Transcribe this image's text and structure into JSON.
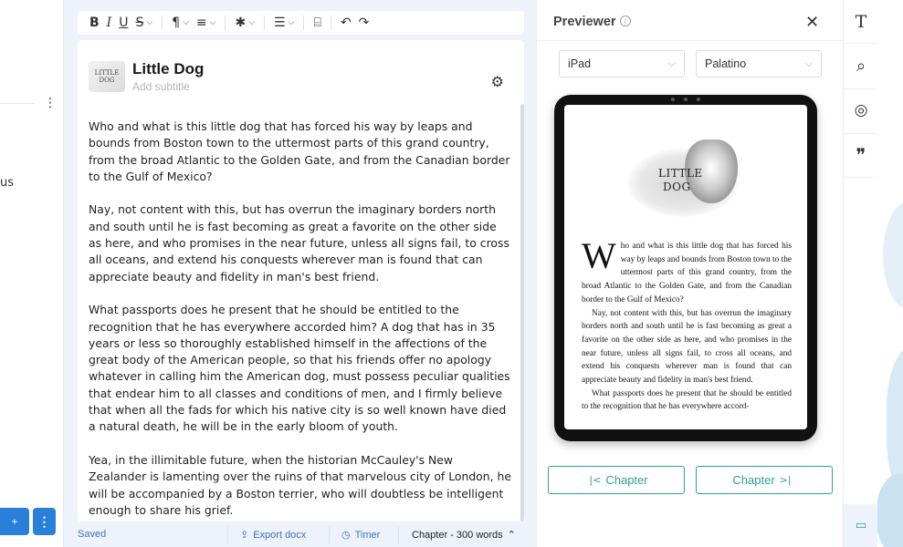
{
  "left_panel": {
    "partial_text": "us",
    "kebab_glyph": "⋮",
    "primary_glyph": "+",
    "primary_kebab_glyph": "⋮"
  },
  "toolbar": {
    "bold": "B",
    "italic": "I",
    "underline": "U",
    "strike": "S",
    "paragraph": "¶",
    "align": "≡",
    "asterisk": "✱",
    "list": "☰",
    "pagebreak": "⌸",
    "undo": "↶",
    "redo": "↷"
  },
  "chapter": {
    "logo_text": "LITTLE DOG",
    "title": "Little Dog",
    "subtitle_placeholder": "Add subtitle",
    "paragraphs": [
      "Who and what is this little dog that has forced his way by leaps and bounds from Boston town to the uttermost parts of this grand country, from the broad Atlantic to the Golden Gate, and from the Canadian border to the Gulf of Mexico?",
      "Nay, not content with this, but has overrun the imaginary borders north and south until he is fast becoming as great a favorite on the other side as here, and who promises in the near future, unless all signs fail, to cross all oceans, and extend his conquests wherever man is found that can appreciate beauty and fidelity in man's best friend.",
      "What passports does he present that he should be entitled to the recognition that he has everywhere accorded him? A dog that has in 35 years or less so thoroughly established himself in the affections of the great body of the American people, so that his friends offer no apology whatever in calling him the American dog, must possess peculiar qualities that endear him to all classes and conditions of men, and I firmly believe that when all the fads for which his native city is so well known have died a natural death, he will be in the early bloom of youth.",
      " Yea, in the illimitable future, when the historian McCauley's New Zealander is lamenting over the ruins of that marvelous city of London, he will be accompanied by a Boston terrier, who will doubtless be intelligent enough to share his grief."
    ]
  },
  "status_bar": {
    "saved": "Saved",
    "export": "Export docx",
    "timer": "Timer",
    "words": "Chapter - 300 words"
  },
  "previewer": {
    "title": "Previewer",
    "info": "i",
    "close": "✕",
    "device": "iPad",
    "font": "Palatino",
    "book_logo_line1": "LITTLE",
    "book_logo_line2": "DOG",
    "dropcap": "W",
    "book_first": "ho and what is this little dog that has forced his way by leaps and bounds from Boston town to the uttermost parts of this grand country, from the broad Atlantic to the Golden Gate, and from the Canadian border to the Gulf of Mexico?",
    "book_second": "Nay, not content with this, but has overrun the imaginary borders north and south until he is fast becoming as great a favorite on the other side as here, and who promises in the near future, unless all signs fail, to cross all oceans, and extend his conquests wherever man is found that can appreciate beauty and fidelity in man's best friend.",
    "book_third": "What passports does he present that he should be entitled to the recognition that he has everywhere accord-",
    "prev_chapter": "Chapter",
    "next_chapter": "Chapter"
  },
  "rail": {
    "typography": "T",
    "search": "⌕",
    "goals": "◎",
    "quotes": "❞",
    "chat": "▭"
  },
  "colors": {
    "accent": "#2e9f96",
    "link": "#3a72c2",
    "primary": "#2a7fd9",
    "editor_bg": "#eef3fb"
  }
}
